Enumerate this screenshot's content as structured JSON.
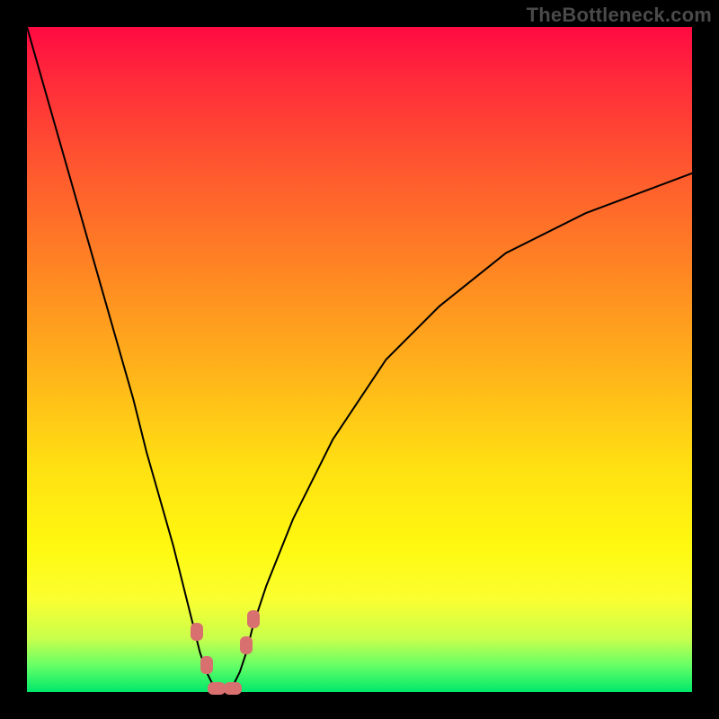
{
  "watermark": "TheBottleneck.com",
  "chart_data": {
    "type": "line",
    "title": "",
    "xlabel": "",
    "ylabel": "",
    "xlim": [
      0,
      100
    ],
    "ylim": [
      0,
      100
    ],
    "series": [
      {
        "name": "bottleneck-curve",
        "x": [
          0,
          4,
          8,
          12,
          16,
          18,
          20,
          22,
          24,
          25,
          26,
          27,
          28,
          29,
          30,
          31,
          32,
          33,
          34,
          36,
          40,
          46,
          54,
          62,
          72,
          84,
          100
        ],
        "y": [
          100,
          86,
          72,
          58,
          44,
          36,
          29,
          22,
          14,
          10,
          6,
          3,
          1,
          0,
          0,
          1,
          3,
          6,
          10,
          16,
          26,
          38,
          50,
          58,
          66,
          72,
          78
        ]
      }
    ],
    "markers": [
      {
        "name": "left-shoulder",
        "x": 25.5,
        "y": 9
      },
      {
        "name": "left-knee",
        "x": 27.0,
        "y": 4
      },
      {
        "name": "trough-left",
        "x": 28.5,
        "y": 0.5
      },
      {
        "name": "trough-right",
        "x": 31.0,
        "y": 0.5
      },
      {
        "name": "right-knee",
        "x": 33.0,
        "y": 7
      },
      {
        "name": "right-shoulder",
        "x": 34.0,
        "y": 11
      }
    ],
    "background_gradient": {
      "top": "#ff0a42",
      "mid": "#ffe012",
      "bottom": "#00e86a"
    }
  }
}
